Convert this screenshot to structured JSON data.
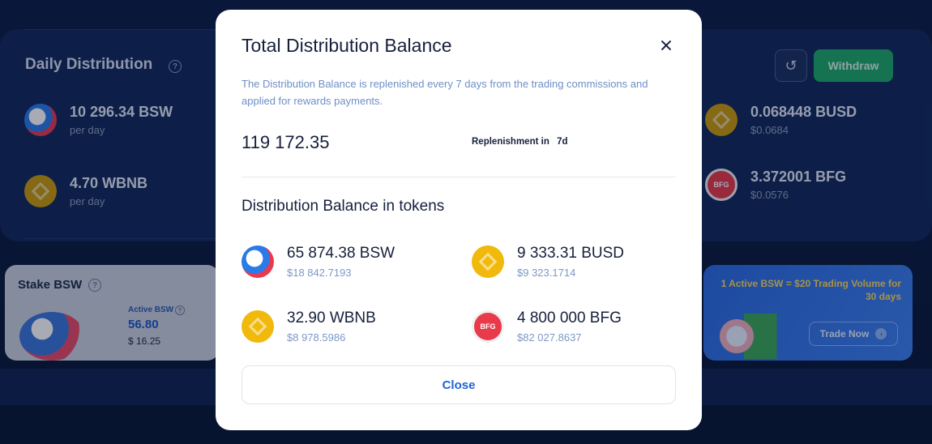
{
  "background": {
    "daily_distribution": {
      "title": "Daily Distribution",
      "tokens": [
        {
          "amount": "10 296.34 BSW",
          "sub": "per day",
          "icon": "bsw-icon"
        },
        {
          "amount": "4.70 WBNB",
          "sub": "per day",
          "icon": "bnb-icon"
        }
      ]
    },
    "right_tokens": [
      {
        "amount": "0.068448 BUSD",
        "sub": "$0.0684",
        "icon": "busd-icon"
      },
      {
        "amount": "3.372001 BFG",
        "sub": "$0.0576",
        "icon": "bfg-icon"
      }
    ],
    "withdraw_label": "Withdraw",
    "stake": {
      "title": "Stake BSW",
      "active_label": "Active BSW",
      "active_value": "56.80",
      "usd_value": "$ 16.25"
    },
    "promo": {
      "text": "1 Active BSW = $20 Trading Volume for 30 days",
      "button_label": "Trade Now"
    }
  },
  "modal": {
    "title": "Total Distribution Balance",
    "description": "The Distribution Balance is replenished every 7 days from the trading commissions and applied for rewards payments.",
    "balance": "119 172.35",
    "replenishment_label": "Replenishment in",
    "replenishment_days": "7d",
    "section_title": "Distribution Balance in tokens",
    "tokens": [
      {
        "amount": "65 874.38 BSW",
        "usd": "$18 842.7193",
        "icon": "bsw-icon"
      },
      {
        "amount": "9 333.31 BUSD",
        "usd": "$9 323.1714",
        "icon": "busd-icon"
      },
      {
        "amount": "32.90 WBNB",
        "usd": "$8 978.5986",
        "icon": "bnb-icon"
      },
      {
        "amount": "4 800 000 BFG",
        "usd": "$82 027.8637",
        "icon": "bfg-icon"
      }
    ],
    "close_label": "Close"
  },
  "colors": {
    "accent_blue": "#1e63d6",
    "withdraw_green": "#1fa968",
    "bnb_yellow": "#f0b90b",
    "bfg_red": "#e83a4a"
  }
}
